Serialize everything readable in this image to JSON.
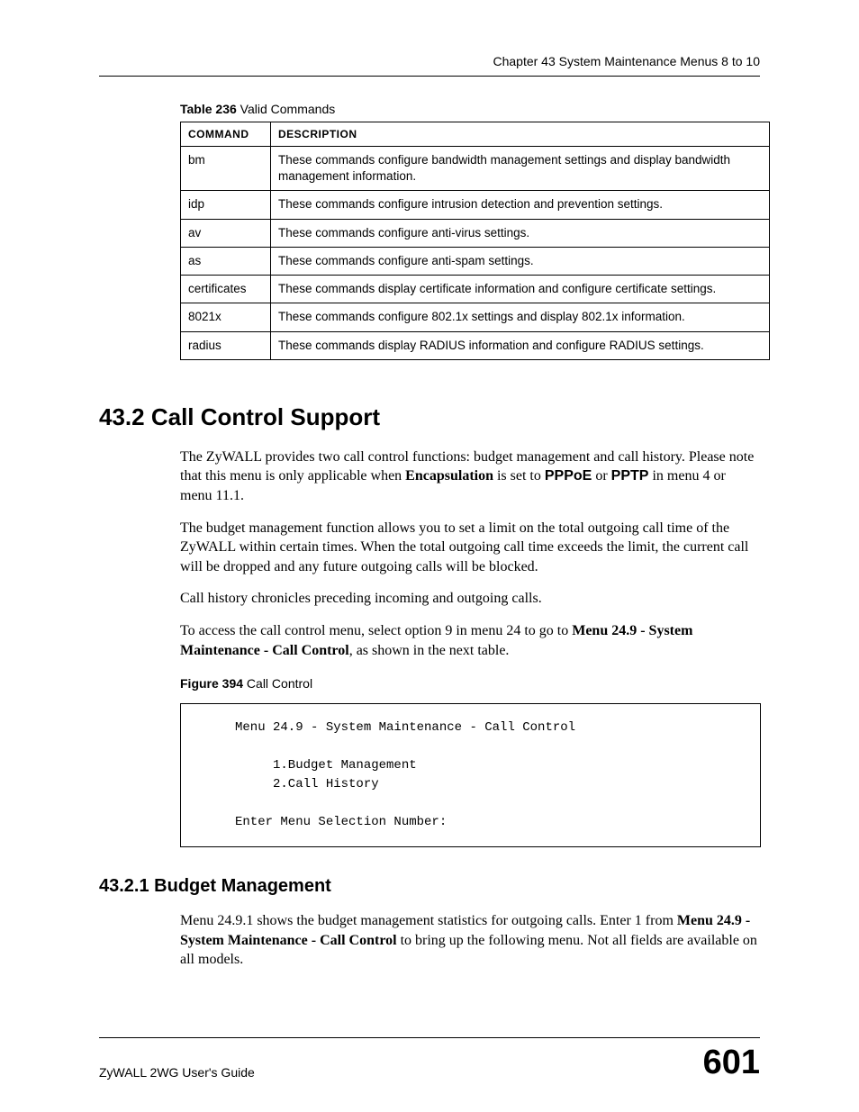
{
  "header": {
    "chapter_line": "Chapter 43 System Maintenance Menus 8 to 10"
  },
  "table_caption": {
    "bold": "Table 236",
    "rest": "   Valid Commands"
  },
  "table": {
    "header_command": "COMMAND",
    "header_description": "DESCRIPTION",
    "rows": [
      {
        "cmd": "bm",
        "desc": "These commands configure bandwidth management settings and display bandwidth management information."
      },
      {
        "cmd": "idp",
        "desc": "These commands configure intrusion detection and prevention settings."
      },
      {
        "cmd": "av",
        "desc": "These commands configure anti-virus settings."
      },
      {
        "cmd": "as",
        "desc": "These commands configure anti-spam settings."
      },
      {
        "cmd": "certificates",
        "desc": "These commands display certificate information and configure certificate settings."
      },
      {
        "cmd": "8021x",
        "desc": "These commands configure 802.1x settings and display 802.1x information."
      },
      {
        "cmd": "radius",
        "desc": "These commands display RADIUS information and configure RADIUS settings."
      }
    ]
  },
  "section": {
    "number_title": "43.2  Call Control Support",
    "p1_a": "The ZyWALL provides two call control functions: budget management and call history. Please note that this menu is only applicable when ",
    "p1_b": "Encapsulation",
    "p1_c": " is set to ",
    "p1_d": "PPPoE",
    "p1_e": " or ",
    "p1_f": "PPTP",
    "p1_g": " in menu 4 or menu 11.1.",
    "p2": "The budget management function allows you to set a limit on the total outgoing call time of the ZyWALL within certain times. When the total outgoing call time exceeds the limit, the current call will be dropped and any future outgoing calls will be blocked.",
    "p3": "Call history chronicles preceding incoming and outgoing calls.",
    "p4_a": "To access the call control menu, select option 9 in menu 24 to go to ",
    "p4_b": "Menu 24.9 - System Maintenance - Call Control",
    "p4_c": ", as shown in the next table."
  },
  "figure_caption": {
    "bold": "Figure 394",
    "rest": "   Call Control"
  },
  "menu_box": "Menu 24.9 - System Maintenance - Call Control\n\n     1.Budget Management\n     2.Call History\n\nEnter Menu Selection Number:",
  "subsection": {
    "title": "43.2.1  Budget Management",
    "p1_a": "Menu 24.9.1 shows the budget management statistics for outgoing calls. Enter 1 from ",
    "p1_b": "Menu 24.9 - System Maintenance - Call Control",
    "p1_c": " to bring up the following menu. Not all fields are available on all models."
  },
  "footer": {
    "left": "ZyWALL 2WG User's Guide",
    "page_number": "601"
  }
}
